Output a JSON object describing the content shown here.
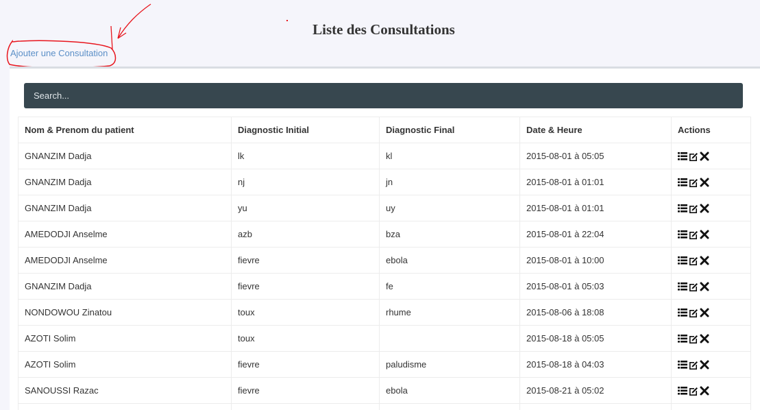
{
  "page": {
    "title": "Liste des Consultations",
    "add_link": "Ajouter une Consultation"
  },
  "search": {
    "placeholder": "Search..."
  },
  "table": {
    "headers": [
      "Nom & Prenom du patient",
      "Diagnostic Initial",
      "Diagnostic Final",
      "Date & Heure",
      "Actions"
    ],
    "rows": [
      {
        "patient": "GNANZIM Dadja",
        "initial": "lk",
        "final": "kl",
        "date": "2015-08-01 à 05:05"
      },
      {
        "patient": "GNANZIM Dadja",
        "initial": "nj",
        "final": "jn",
        "date": "2015-08-01 à 01:01"
      },
      {
        "patient": "GNANZIM Dadja",
        "initial": "yu",
        "final": "uy",
        "date": "2015-08-01 à 01:01"
      },
      {
        "patient": "AMEDODJI Anselme",
        "initial": "azb",
        "final": "bza",
        "date": "2015-08-01 à 22:04"
      },
      {
        "patient": "AMEDODJI Anselme",
        "initial": "fievre",
        "final": "ebola",
        "date": "2015-08-01 à 10:00"
      },
      {
        "patient": "GNANZIM Dadja",
        "initial": "fievre",
        "final": "fe",
        "date": "2015-08-01 à 05:03"
      },
      {
        "patient": "NONDOWOU Zinatou",
        "initial": "toux",
        "final": "rhume",
        "date": "2015-08-06 à 18:08"
      },
      {
        "patient": "AZOTI Solim",
        "initial": "toux",
        "final": "",
        "date": "2015-08-18 à 05:05"
      },
      {
        "patient": "AZOTI Solim",
        "initial": "fievre",
        "final": "paludisme",
        "date": "2015-08-18 à 04:03"
      },
      {
        "patient": "SANOUSSI Razac",
        "initial": "fievre",
        "final": "ebola",
        "date": "2015-08-21 à 05:02"
      },
      {
        "patient": "",
        "initial": "",
        "final": "",
        "date": ""
      }
    ],
    "row_actions": [
      "list-icon",
      "edit-icon",
      "delete-icon"
    ]
  },
  "colors": {
    "search_bg": "#37474f",
    "link": "#5b8fc7",
    "annotation": "#e8141c"
  }
}
